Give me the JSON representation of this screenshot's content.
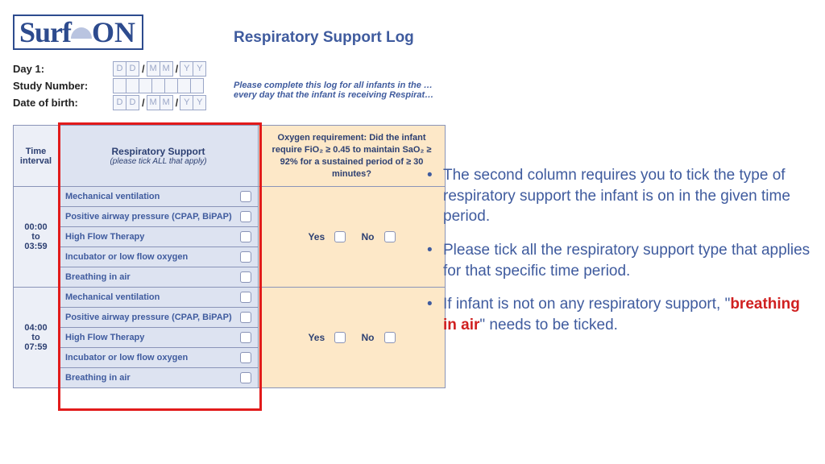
{
  "logo": {
    "part1": "Surf",
    "part2": "ON"
  },
  "title": "Respiratory Support Log",
  "meta": {
    "day1_label": "Day 1:",
    "study_label": "Study Number:",
    "dob_label": "Date of birth:",
    "D": "D",
    "M": "M",
    "Y": "Y",
    "slash": "/"
  },
  "instruction": "Please complete this log for all infants in the … every day that the infant is receiving Respirat…",
  "headers": {
    "time": "Time interval",
    "resp_title": "Respiratory Support",
    "resp_sub": "(please tick ALL that apply)",
    "oxy": "Oxygen requirement: Did the infant require FiO₂ ≥ 0.45 to maintain SaO₂ ≥ 92% for a sustained period of ≥ 30 minutes?"
  },
  "resp_options": [
    "Mechanical ventilation",
    "Positive airway pressure (CPAP, BiPAP)",
    "High Flow Therapy",
    "Incubator or low flow oxygen",
    "Breathing in air"
  ],
  "rows": [
    {
      "from": "00:00",
      "mid": "to",
      "to": "03:59"
    },
    {
      "from": "04:00",
      "mid": "to",
      "to": "07:59"
    }
  ],
  "yesno": {
    "yes": "Yes",
    "no": "No"
  },
  "bullets": {
    "b1": "The second column requires you to tick the type of respiratory support the infant is on in the given time period.",
    "b2": "Please tick all the respiratory support type that applies for that specific time period.",
    "b3a": "If infant is not on any respiratory support, \"",
    "b3b": "breathing in air",
    "b3c": "\" needs to be ticked."
  }
}
